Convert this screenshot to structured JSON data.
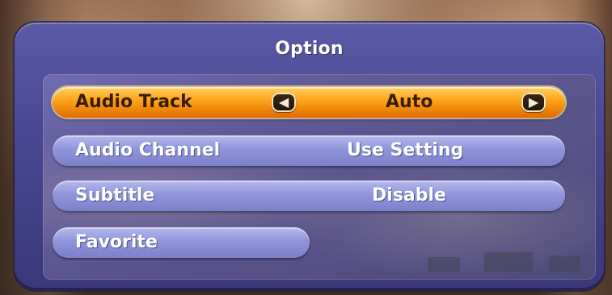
{
  "menu": {
    "title": "Option",
    "rows": [
      {
        "label": "Audio Track",
        "value": "Auto",
        "selected": true
      },
      {
        "label": "Audio Channel",
        "value": "Use Setting",
        "selected": false
      },
      {
        "label": "Subtitle",
        "value": "Disable",
        "selected": false
      },
      {
        "label": "Favorite",
        "value": "",
        "selected": false
      }
    ],
    "arrows": {
      "left_icon": "arrow-left-icon",
      "right_icon": "arrow-right-icon"
    }
  },
  "colors": {
    "panel": "#4a4893",
    "row_normal": "#8f95db",
    "row_selected": "#ffac22",
    "text": "#ffffff",
    "text_selected": "#3a1d00"
  }
}
